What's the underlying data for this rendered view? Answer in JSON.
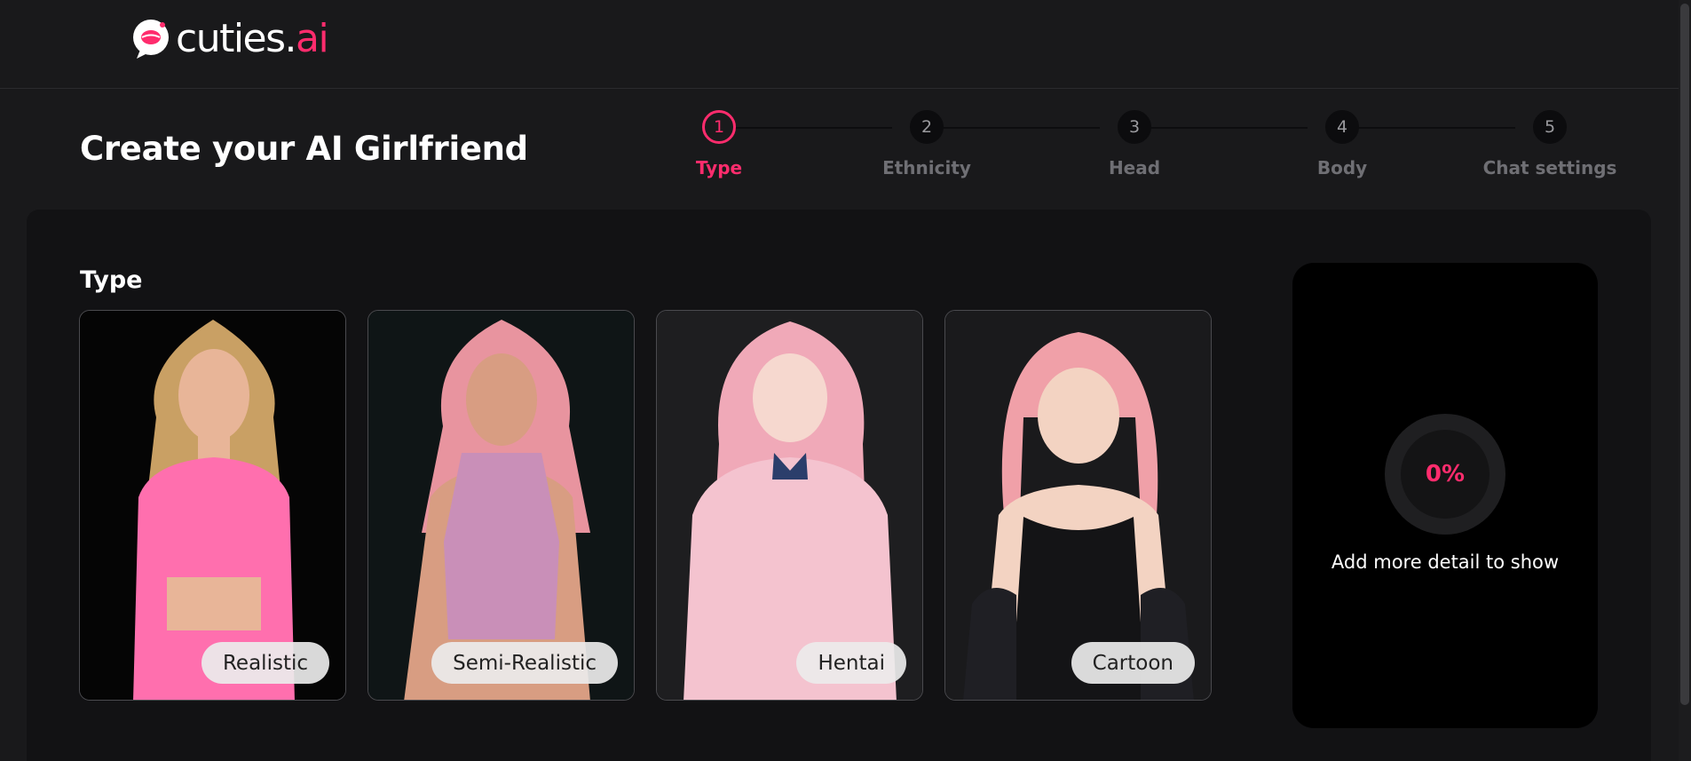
{
  "brand": {
    "name_main": "cuties.",
    "name_accent": "ai",
    "accent_color": "#ff2c6d",
    "icon": "kiss-lips-bubble-icon"
  },
  "page": {
    "title": "Create your AI Girlfriend"
  },
  "stepper": {
    "current_step": 1,
    "steps": [
      {
        "number": "1",
        "label": "Type"
      },
      {
        "number": "2",
        "label": "Ethnicity"
      },
      {
        "number": "3",
        "label": "Head"
      },
      {
        "number": "4",
        "label": "Body"
      },
      {
        "number": "5",
        "label": "Chat settings"
      }
    ]
  },
  "section": {
    "title": "Type"
  },
  "types": [
    {
      "label": "Realistic",
      "hair": "#c9a064",
      "outfit": "#ff6fae",
      "skin": "#e8b598",
      "bg": "#050505"
    },
    {
      "label": "Semi-Realistic",
      "hair": "#e8949f",
      "outfit": "#c98fb8",
      "skin": "#d89d82",
      "bg": "#0f1516"
    },
    {
      "label": "Hentai",
      "hair": "#f0a9b8",
      "outfit": "#f4c3cf",
      "skin": "#f6d8cf",
      "bg": "#1e1e20"
    },
    {
      "label": "Cartoon",
      "hair": "#f0a0a8",
      "outfit": "#141416",
      "skin": "#f3d3c2",
      "bg": "#1a1a1c"
    }
  ],
  "preview": {
    "progress": "0%",
    "progress_value": 0,
    "message": "Add more detail to show"
  }
}
